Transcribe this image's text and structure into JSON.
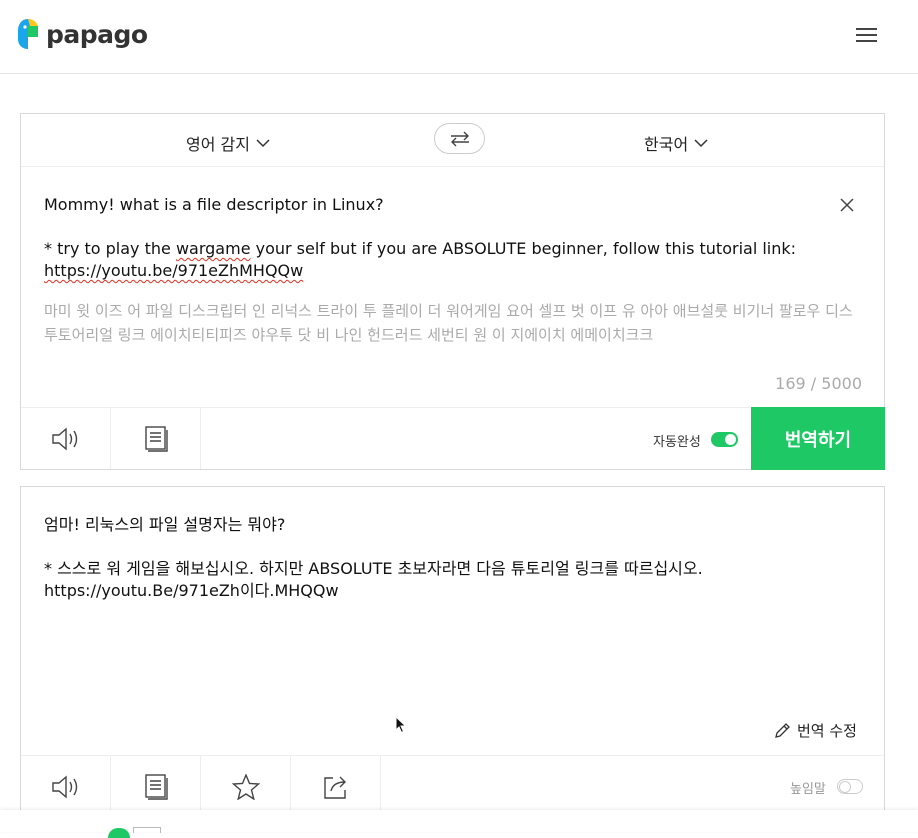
{
  "header": {
    "brand": "papago"
  },
  "languages": {
    "source": "영어 감지",
    "target": "한국어"
  },
  "source": {
    "line1": "Mommy! what is a file descriptor in Linux?",
    "line2_a": "* try to play the ",
    "line2_b": "wargame",
    "line2_c": " your self but if you are ABSOLUTE beginner, follow this tutorial link: ",
    "link": "https://youtu.be/971eZhMHQQw",
    "pronunciation": "마미 윗 이즈 어 파일 디스크립터 인 리넉스 트라이 투 플레이 더 워어게임 요어 셀프 벗 이프 유 아아 애브설룻 비기너 팔로우 디스 투토어리얼 링크 에이치티티피즈 야우투 닷 비 나인 헌드러드 세번티 원 이 지에이치 에메이치크크",
    "counter": "169 / 5000",
    "auto_complete_label": "자동완성",
    "translate_label": "번역하기"
  },
  "target": {
    "text": "엄마! 리눅스의 파일 설명자는 뭐야?\n\n* 스스로 워 게임을 해보십시오. 하지만 ABSOLUTE 초보자라면 다음 튜토리얼 링크를 따르십시오.\nhttps://youtu.Be/971eZh이다.MHQQw",
    "edit_label": "번역 수정",
    "honorific_label": "높임말"
  },
  "colors": {
    "accent": "#1ec864"
  }
}
